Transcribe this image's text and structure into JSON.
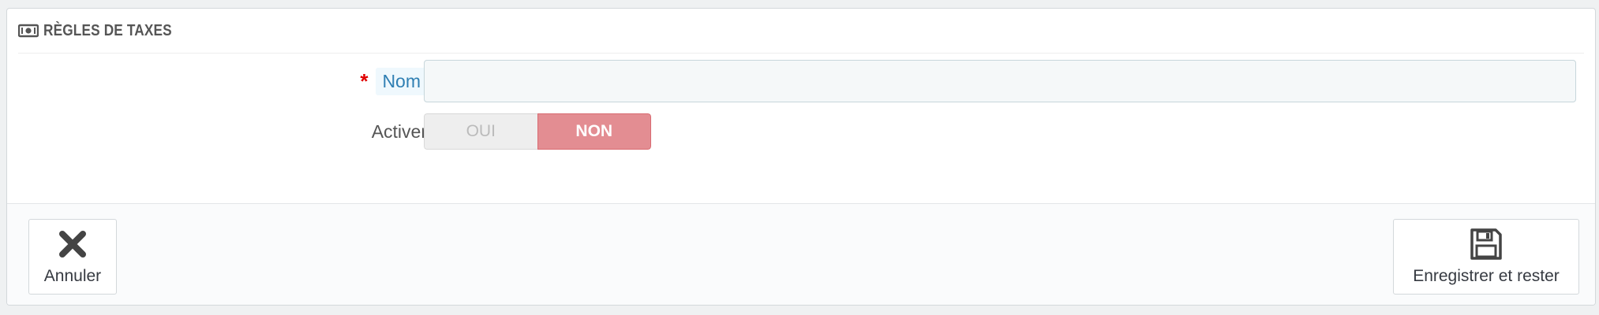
{
  "panel": {
    "title": "RÈGLES DE TAXES",
    "title_icon": "money-icon"
  },
  "form": {
    "name": {
      "label": "Nom",
      "required_mark": "*",
      "value": "",
      "placeholder": ""
    },
    "enable": {
      "label": "Activer",
      "yes_label": "OUI",
      "no_label": "NON",
      "selected": "NON"
    }
  },
  "footer": {
    "cancel_label": "Annuler",
    "cancel_icon": "close-icon",
    "save_stay_label": "Enregistrer et rester",
    "save_stay_icon": "floppy-disk-icon"
  },
  "colors": {
    "accent_link": "#2f7fb3",
    "required": "#e00000",
    "switch_off": "#e38d92"
  }
}
